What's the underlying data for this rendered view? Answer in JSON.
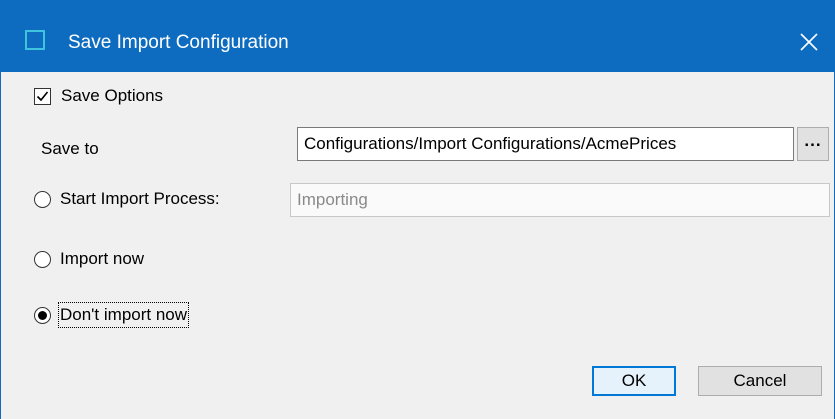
{
  "window": {
    "title": "Save Import Configuration"
  },
  "options": {
    "save_options_label": "Save Options",
    "save_options_checked": true,
    "save_to_label": "Save to",
    "save_to_value": "Configurations/Import Configurations/AcmePrices",
    "browse_label": "...",
    "start_process_label": "Start Import Process:",
    "start_process_value": "Importing",
    "import_now_label": "Import now",
    "dont_import_label": "Don't import now",
    "selected_option": "dont_import_now"
  },
  "footer": {
    "ok_label": "OK",
    "cancel_label": "Cancel"
  },
  "colors": {
    "titlebar": "#0e6cc0",
    "default_button_border": "#0078d7"
  }
}
